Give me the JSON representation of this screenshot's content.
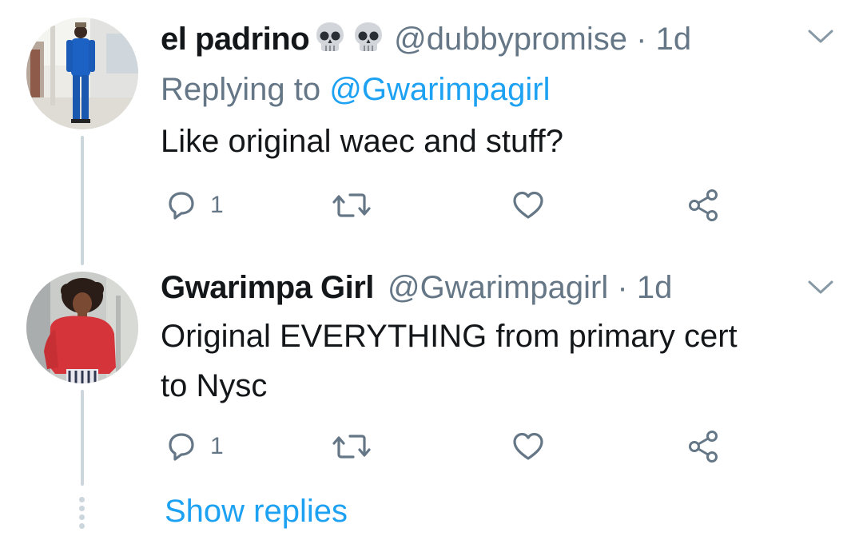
{
  "tweets": [
    {
      "display_name": "el padrino",
      "emojis": [
        "skull-icon",
        "skull-icon"
      ],
      "handle": "@dubbypromise",
      "separator": "·",
      "time": "1d",
      "replying_label": "Replying to",
      "replying_to": "@Gwarimpagirl",
      "text": "Like original waec and stuff?",
      "reply_count": "1"
    },
    {
      "display_name": "Gwarimpa Girl",
      "handle": "@Gwarimpagirl",
      "separator": "·",
      "time": "1d",
      "text_lines": [
        "Original EVERYTHING from primary cert",
        "to Nysc"
      ],
      "reply_count": "1"
    }
  ],
  "show_replies_label": "Show replies",
  "colors": {
    "text": "#14171a",
    "secondary": "#657786",
    "link": "#1da1f2",
    "thread_line": "#ccd6dd"
  }
}
